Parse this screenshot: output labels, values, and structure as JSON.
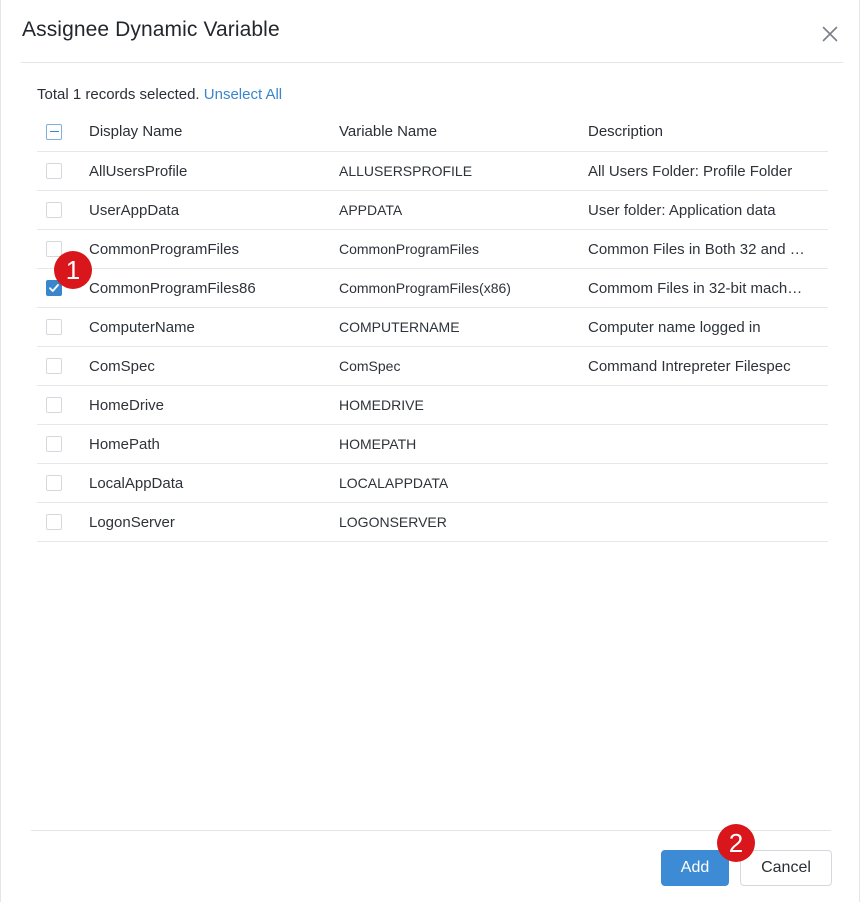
{
  "dialog": {
    "title": "Assignee Dynamic Variable",
    "close_icon": "close-icon"
  },
  "selection": {
    "summary": "Total 1 records selected.",
    "unselect_all": "Unselect All"
  },
  "table": {
    "columns": [
      "Display Name",
      "Variable Name",
      "Description"
    ],
    "rows": [
      {
        "display_name": "AllUsersProfile",
        "variable_name": "ALLUSERSPROFILE",
        "description": "All Users Folder: Profile Folder",
        "checked": false
      },
      {
        "display_name": "UserAppData",
        "variable_name": "APPDATA",
        "description": "User folder: Application data",
        "checked": false
      },
      {
        "display_name": "CommonProgramFiles",
        "variable_name": "CommonProgramFiles",
        "description": "Common Files in Both 32 and …",
        "checked": false
      },
      {
        "display_name": "CommonProgramFiles86",
        "variable_name": "CommonProgramFiles(x86)",
        "description": "Commom Files in 32-bit mach…",
        "checked": true
      },
      {
        "display_name": "ComputerName",
        "variable_name": "COMPUTERNAME",
        "description": "Computer name logged in",
        "checked": false
      },
      {
        "display_name": "ComSpec",
        "variable_name": "ComSpec",
        "description": "Command Intrepreter Filespec",
        "checked": false
      },
      {
        "display_name": "HomeDrive",
        "variable_name": "HOMEDRIVE",
        "description": "",
        "checked": false
      },
      {
        "display_name": "HomePath",
        "variable_name": "HOMEPATH",
        "description": "",
        "checked": false
      },
      {
        "display_name": "LocalAppData",
        "variable_name": "LOCALAPPDATA",
        "description": "",
        "checked": false
      },
      {
        "display_name": "LogonServer",
        "variable_name": "LOGONSERVER",
        "description": "",
        "checked": false
      }
    ]
  },
  "footer": {
    "add_label": "Add",
    "cancel_label": "Cancel"
  },
  "markers": {
    "first": "1",
    "second": "2"
  },
  "colors": {
    "accent": "#3d8bd4",
    "link": "#3a86cc",
    "marker": "#d8161b"
  }
}
